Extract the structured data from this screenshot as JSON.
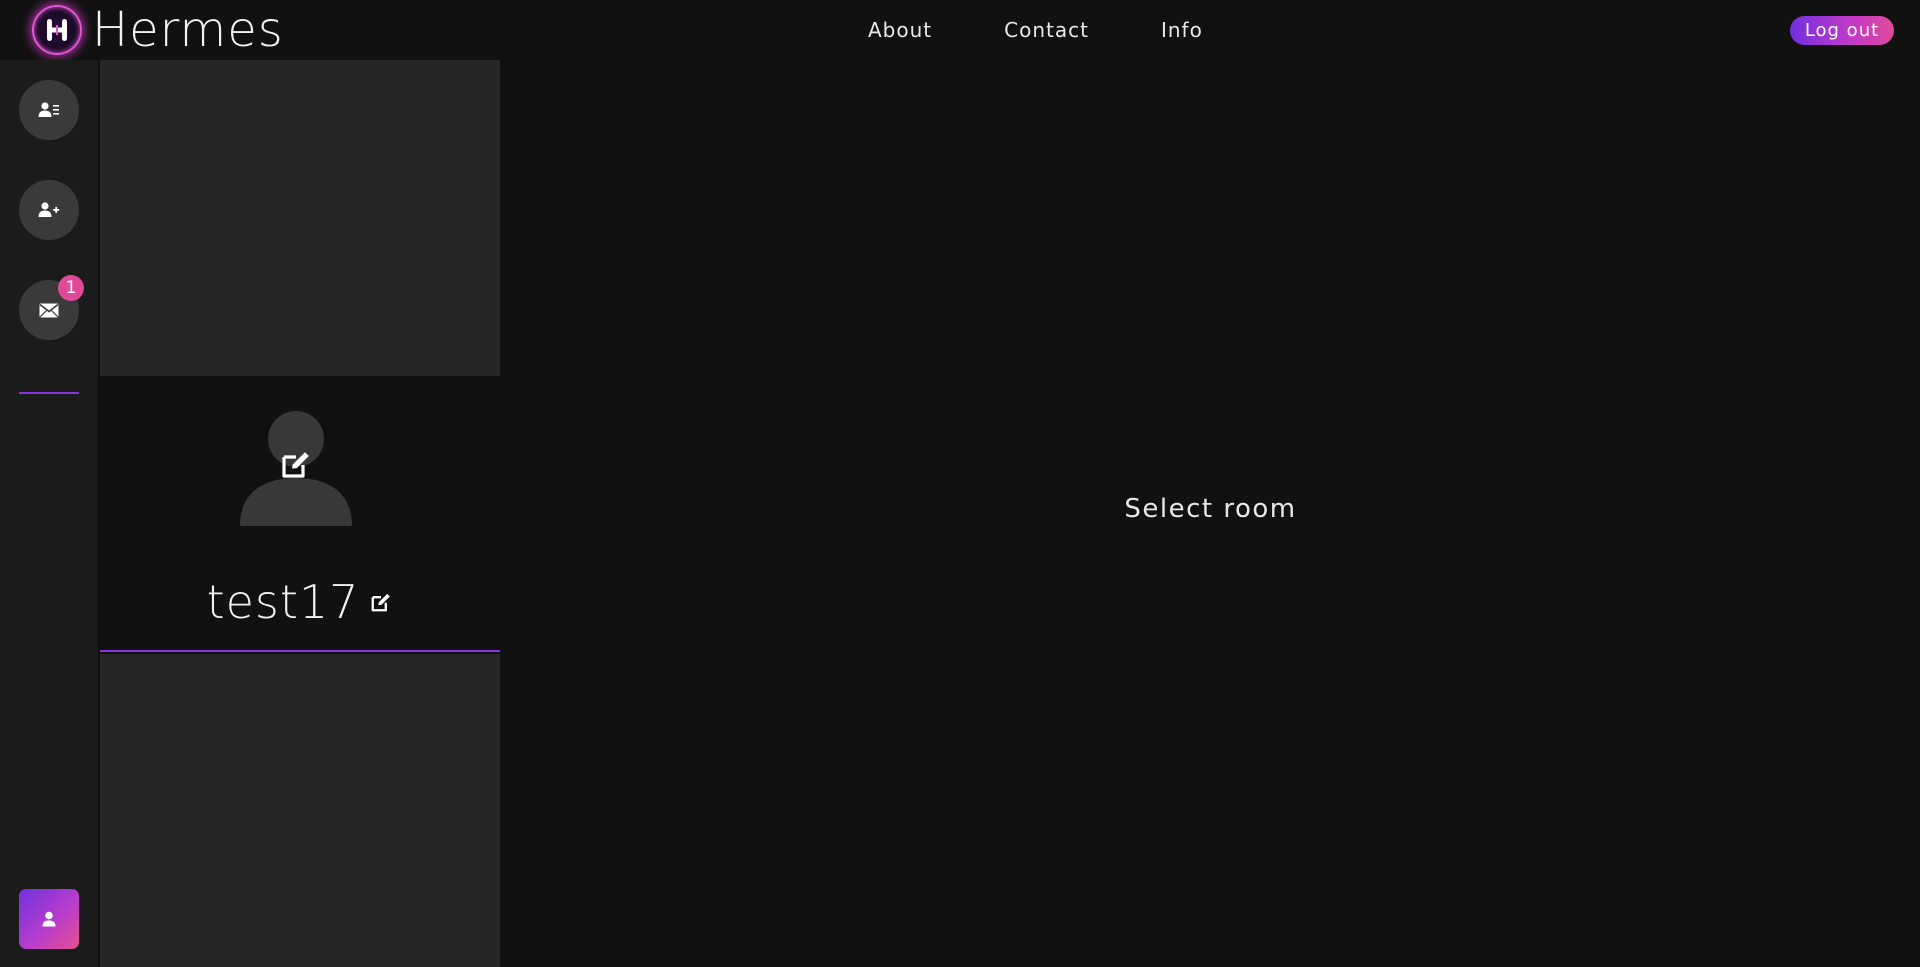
{
  "brand": {
    "name": "Hermes",
    "logo_letter": "H",
    "logo_color": "#e255d6"
  },
  "nav": {
    "links": [
      "About",
      "Contact",
      "Info"
    ]
  },
  "auth": {
    "logout_label": "Log out"
  },
  "rail": {
    "items": [
      {
        "name": "contacts-list",
        "icon": "user-list-icon"
      },
      {
        "name": "add-contact",
        "icon": "user-plus-icon"
      },
      {
        "name": "messages",
        "icon": "envelope-icon",
        "badge": "1"
      }
    ],
    "profile_icon": "user-icon"
  },
  "profile": {
    "username": "test17",
    "avatar_icon": "user-silhouette-icon",
    "edit_icon": "edit-icon"
  },
  "main": {
    "empty_message": "Select room"
  },
  "colors": {
    "background": "#111111",
    "panel": "#262626",
    "rail": "#1b1b1b",
    "accent_purple": "#8c33e0",
    "accent_pink": "#e0489a",
    "button_grey": "#3a3a3a"
  }
}
